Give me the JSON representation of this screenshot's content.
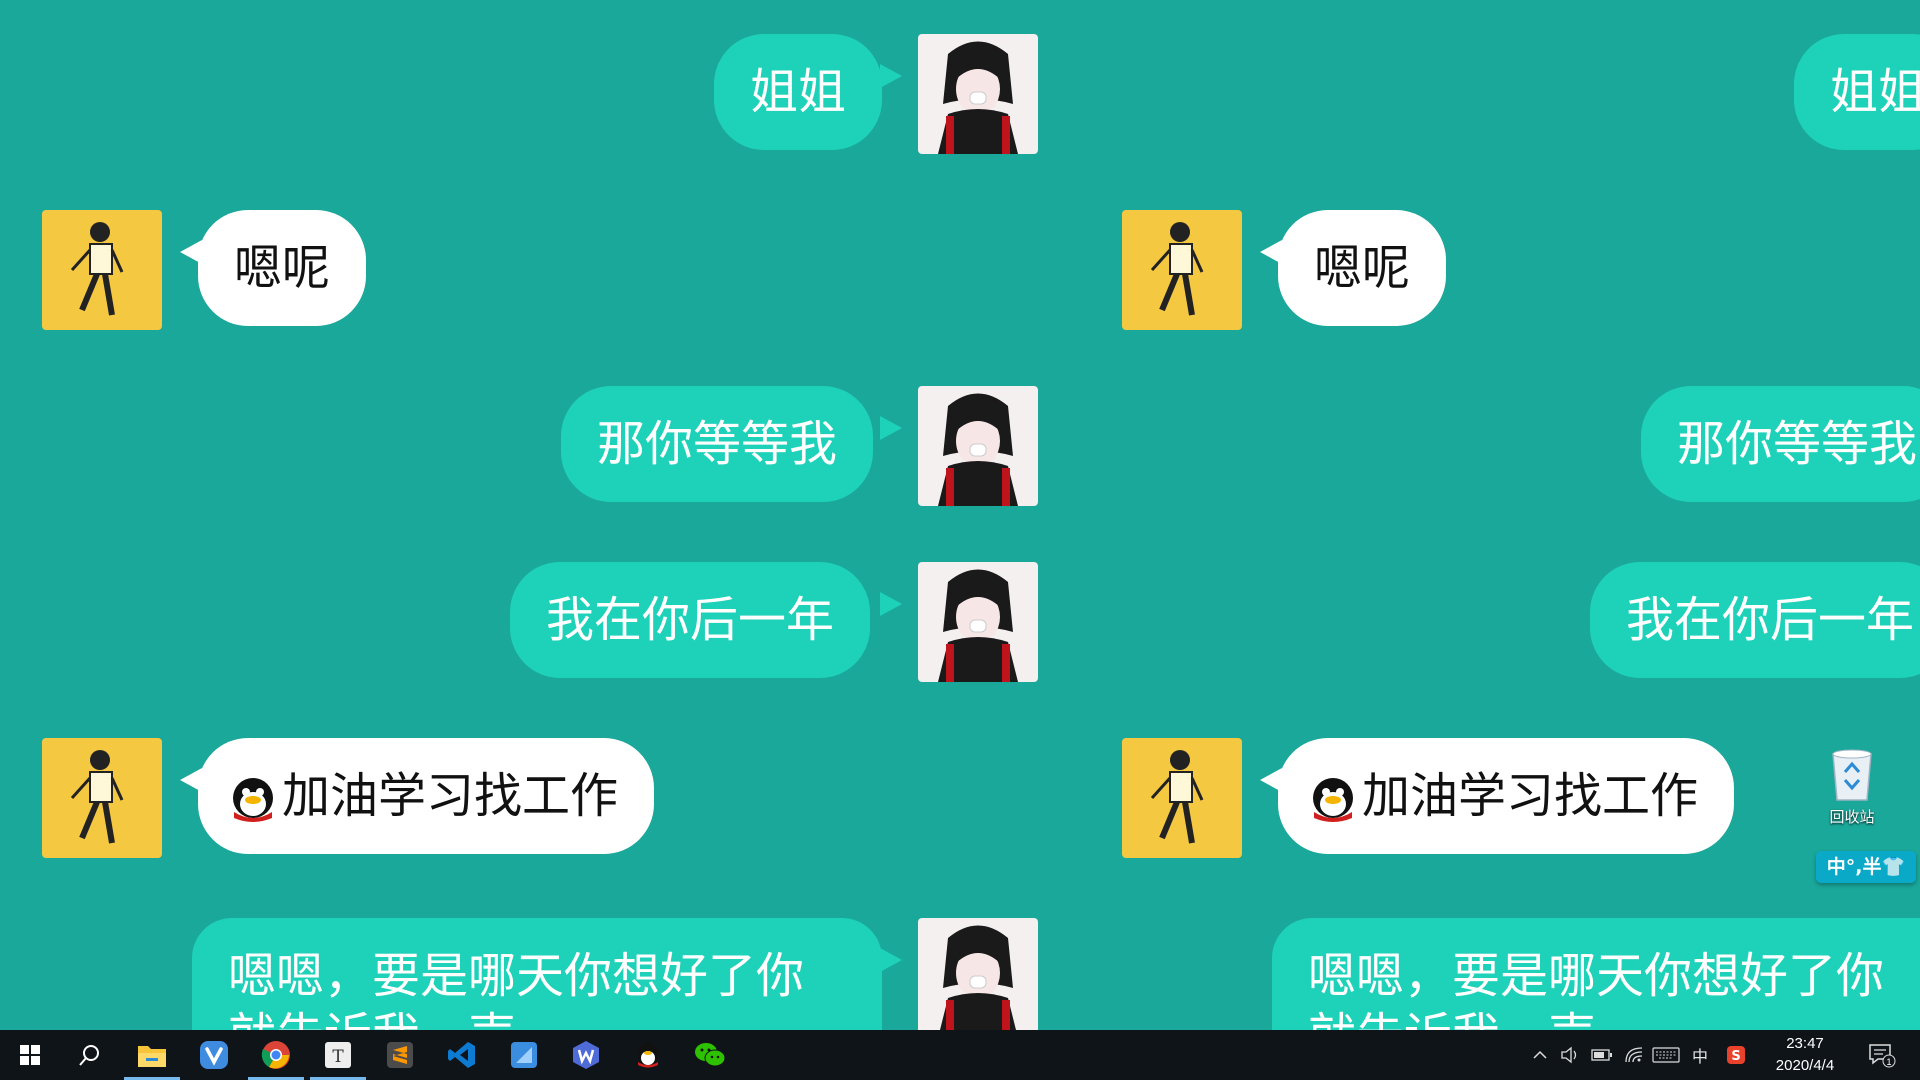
{
  "chat": {
    "messages": [
      {
        "side": "sent",
        "text": "姐姐"
      },
      {
        "side": "recv",
        "text": "嗯呢"
      },
      {
        "side": "sent",
        "text": "那你等等我"
      },
      {
        "side": "sent",
        "text": "我在你后一年"
      },
      {
        "side": "recv",
        "text": "加油学习找工作",
        "emoji": "qq-penguin-emoji"
      },
      {
        "side": "sent",
        "text": "嗯嗯，要是哪天你想好了你就告诉我一声"
      }
    ]
  },
  "desktop": {
    "recycle_bin_label": "回收站",
    "ime_float_text": "中°,半👕"
  },
  "taskbar": {
    "apps": [
      "start-icon",
      "search-icon",
      "file-explorer-icon",
      "vivaldi-icon",
      "chrome-icon",
      "typora-icon",
      "sublime-text-icon",
      "vscode-icon",
      "wps-writer-icon",
      "qq-icon",
      "wechat-icon"
    ],
    "tray_ime": "中",
    "time": "23:47",
    "date": "2020/4/4",
    "notification_count": "1"
  },
  "colors": {
    "background": "#1aa89b",
    "sent_bubble": "#1ed1b9",
    "recv_bubble": "#ffffff",
    "taskbar": "#0f1419"
  }
}
